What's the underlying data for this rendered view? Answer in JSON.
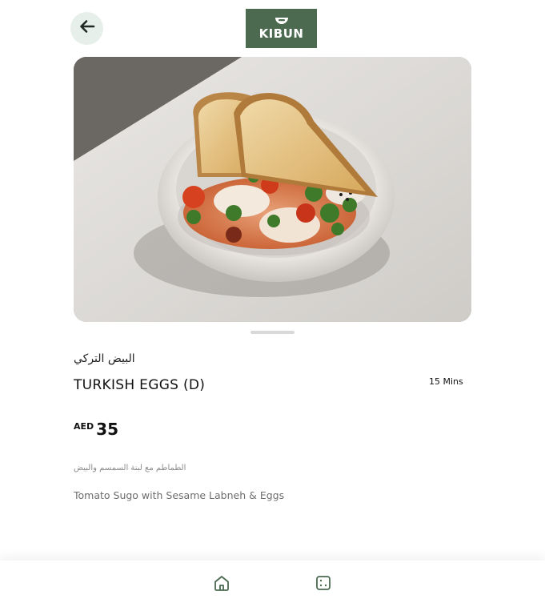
{
  "header": {
    "back_icon": "arrow-left-icon",
    "logo_text": "KIBUN",
    "accent_color": "#4b6a4f",
    "back_bg_color": "#e6efea"
  },
  "item": {
    "name_ar": "البيض التركي",
    "name_en": "TURKISH EGGS (D)",
    "prep_time": "15 Mins",
    "price_currency": "AED",
    "price_value": "35",
    "description_ar": "الطماطم مع لبنة السمسم والبيض",
    "description_en": "Tomato Sugo with Sesame Labneh & Eggs"
  },
  "bottom_nav": {
    "items": [
      {
        "icon": "home-icon"
      },
      {
        "icon": "menu-icon"
      }
    ]
  }
}
